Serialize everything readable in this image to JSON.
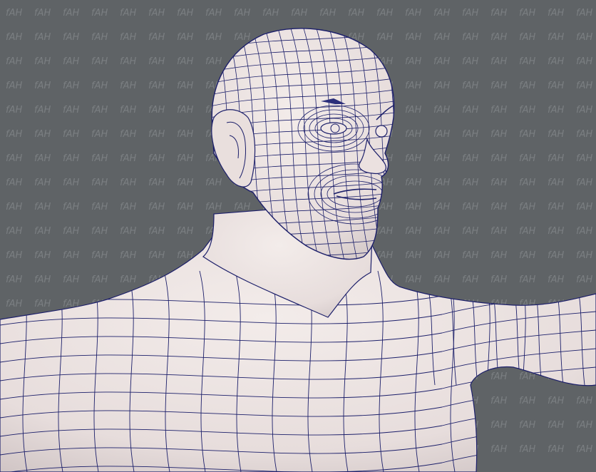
{
  "scene": {
    "background_color": "#5f6366",
    "watermark": {
      "text": "fAH",
      "color": "#7b7f82"
    },
    "model": {
      "subject": "male-base-mesh-wireframe",
      "skin_color": "#ece3e2",
      "skin_shadow_color": "#cfc4c4",
      "wire_color": "#1c1f6a"
    }
  }
}
